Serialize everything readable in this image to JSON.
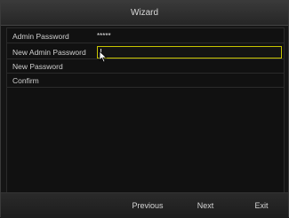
{
  "window": {
    "title": "Wizard"
  },
  "form": {
    "admin_password": {
      "label": "Admin Password",
      "value": "*****"
    },
    "new_admin_password": {
      "label": "New Admin Password",
      "value": ""
    },
    "new_password": {
      "label": "New Password"
    },
    "confirm": {
      "label": "Confirm"
    }
  },
  "footer": {
    "previous_label": "Previous",
    "next_label": "Next",
    "exit_label": "Exit"
  },
  "colors": {
    "focus_border": "#c8c400"
  }
}
